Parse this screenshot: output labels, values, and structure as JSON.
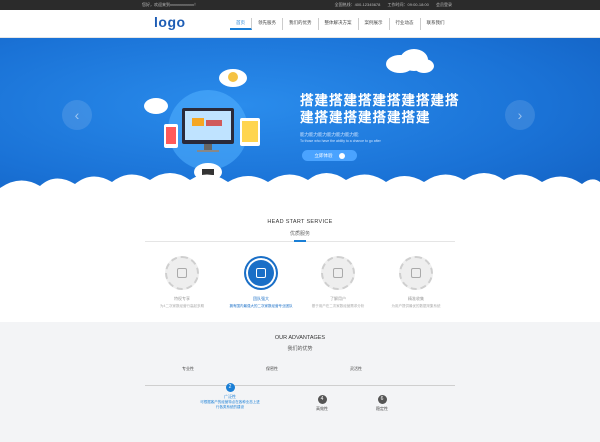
{
  "topbar": {
    "welcome": "您好，欢迎来到xxxxxxxxxxxx！",
    "hotline": "全国热线：400-12345678",
    "hours": "工作时间：09:00-18:00",
    "login": "会员登录"
  },
  "header": {
    "logo": "logo",
    "nav": [
      "首页",
      "领先服务",
      "我们的优势",
      "整体解决方案",
      "案例展示",
      "行业动态",
      "联系我们"
    ],
    "active_index": 0
  },
  "banner": {
    "headline": "搭建搭建搭建搭建搭建搭建搭建搭建搭建搭建",
    "sub_cn": "能力能力能力能力能力能力能",
    "sub_en": "To those who have the ability to a chance to go after",
    "cta": "立即体验",
    "prev": "‹",
    "next": "›"
  },
  "services": {
    "title": "HEAD START SERVICE",
    "subtitle": "优质服务",
    "items": [
      {
        "name": "特权专享",
        "desc": "为4二次家数经营行高起多期",
        "active": false
      },
      {
        "name": "团队强大",
        "desc": "拥有国内最强大的二次家数经营专业团队",
        "active": true
      },
      {
        "name": "了解用户",
        "desc": "基于用户在二次家数经营需求分析",
        "active": false
      },
      {
        "name": "精准收集",
        "desc": "为用户提供最优的数据采集系统",
        "active": false
      }
    ]
  },
  "advantages": {
    "title": "OUR ADVANTAGES",
    "subtitle": "我们的优势",
    "steps": [
      {
        "label": "专业性",
        "num": "",
        "pos": "top"
      },
      {
        "label": "广泛性",
        "num": "2",
        "pos": "bottom",
        "desc": "可根据客户的经营特点在各种业态上进行各类系统的建设",
        "active": true
      },
      {
        "label": "保密性",
        "num": "",
        "pos": "top"
      },
      {
        "label": "高效性",
        "num": "4",
        "pos": "bottom"
      },
      {
        "label": "灵活性",
        "num": "",
        "pos": "top"
      },
      {
        "label": "稳定性",
        "num": "6",
        "pos": "bottom"
      }
    ]
  }
}
